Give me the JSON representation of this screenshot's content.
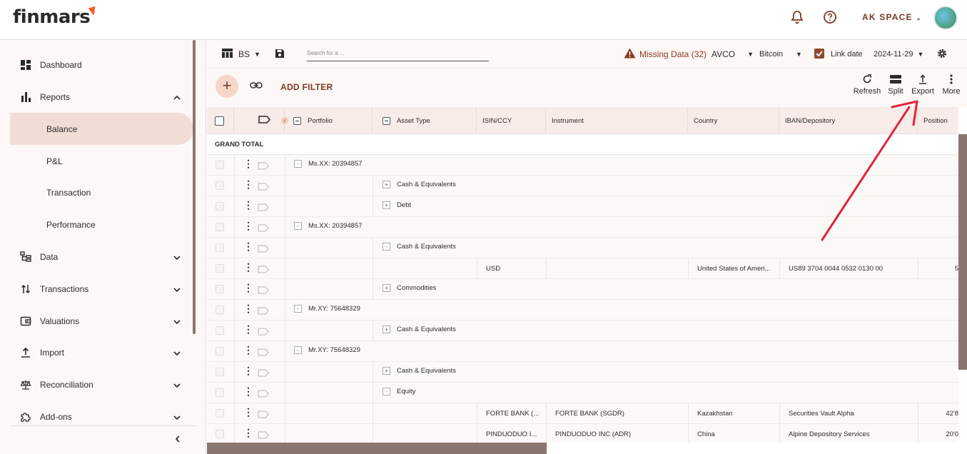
{
  "app": {
    "logo": "finmars",
    "space_name": "AK SPACE"
  },
  "sidebar": {
    "items": [
      {
        "label": "Dashboard",
        "icon": "dashboard-icon"
      },
      {
        "label": "Reports",
        "icon": "bar-chart-icon",
        "expanded": true
      },
      {
        "label": "Balance",
        "sub": true,
        "active": true
      },
      {
        "label": "P&L",
        "sub": true
      },
      {
        "label": "Transaction",
        "sub": true
      },
      {
        "label": "Performance",
        "sub": true
      },
      {
        "label": "Data",
        "icon": "data-tree-icon"
      },
      {
        "label": "Transactions",
        "icon": "transactions-icon"
      },
      {
        "label": "Valuations",
        "icon": "wallet-icon"
      },
      {
        "label": "Import",
        "icon": "upload-icon"
      },
      {
        "label": "Reconciliation",
        "icon": "scales-icon"
      },
      {
        "label": "Add-ons",
        "icon": "puzzle-icon"
      }
    ]
  },
  "toolbar": {
    "layout_name": "BS",
    "search_placeholder": "Search for a ...",
    "missing_data": "Missing Data (32)",
    "cost_method": "AVCO",
    "currency": "Bitcoin",
    "link_date_label": "Link date",
    "link_date_checked": true,
    "date": "2024-11-29",
    "add_filter": "ADD FILTER",
    "refresh": "Refresh",
    "split": "Split",
    "export": "Export",
    "more": "More"
  },
  "grid": {
    "columns": [
      "Portfolio",
      "Asset Type",
      "ISIN/CCY",
      "Instrument",
      "Country",
      "IBAN/Depository",
      "Position"
    ],
    "grand_total": "GRAND TOTAL",
    "rows": [
      {
        "type": "group1",
        "sign": "-",
        "label": "Ms.XX: 20394857"
      },
      {
        "type": "group2",
        "sign": "+",
        "label": "Cash & Equivalents"
      },
      {
        "type": "group2",
        "sign": "+",
        "label": "Debt"
      },
      {
        "type": "group1",
        "sign": "-",
        "label": "Ms.XX: 20394857"
      },
      {
        "type": "group2",
        "sign": "-",
        "label": "Cash & Equivalents"
      },
      {
        "type": "data",
        "isin": "USD",
        "instrument": "",
        "country": "United States of Ameri...",
        "iban": "US89 3704 0044 0532 0130 00",
        "position": "5"
      },
      {
        "type": "group2",
        "sign": "+",
        "label": "Commodities"
      },
      {
        "type": "group1",
        "sign": "-",
        "label": "Mr.XY: 75648329"
      },
      {
        "type": "group2",
        "sign": "+",
        "label": "Cash & Equivalents"
      },
      {
        "type": "group1",
        "sign": "-",
        "label": "Mr.XY: 75648329"
      },
      {
        "type": "group2",
        "sign": "+",
        "label": "Cash & Equivalents"
      },
      {
        "type": "group2",
        "sign": "-",
        "label": "Equity"
      },
      {
        "type": "data",
        "isin": "FORTE BANK (...",
        "instrument": "FORTE BANK (SGDR)",
        "country": "Kazakhstan",
        "iban": "Securities Vault Alpha",
        "position": "42'8"
      },
      {
        "type": "data",
        "isin": "PINDUODUO I...",
        "instrument": "PINDUODUO INC (ADR)",
        "country": "China",
        "iban": "Alpine Depository Services",
        "position": "20'0"
      }
    ]
  },
  "colors": {
    "accent": "#7a3a22",
    "brand_orange": "#f05a28",
    "annotation_arrow": "#e0243a",
    "warning": "#8b3a1e"
  }
}
